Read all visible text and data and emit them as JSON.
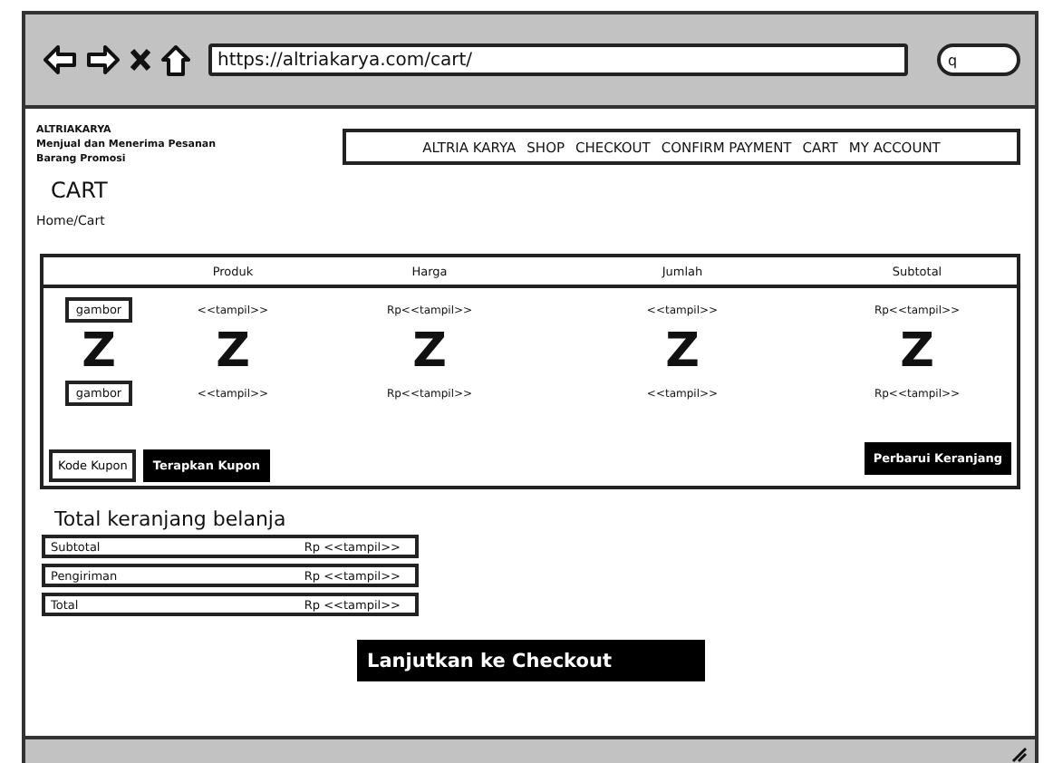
{
  "browser": {
    "url": "https://altriakarya.com/cart/",
    "search": {
      "placeholder": "q"
    }
  },
  "header": {
    "brand": "ALTRIAKARYA",
    "tagline": [
      "Menjual dan Menerima Pesanan",
      "Barang Promosi"
    ],
    "nav": [
      "ALTRIA KARYA",
      "SHOP",
      "CHECKOUT",
      "CONFIRM PAYMENT",
      "CART",
      "MY ACCOUNT"
    ]
  },
  "page_title": "CART",
  "breadcrumb": "Home/Cart",
  "cart_table": {
    "columns": [
      "",
      "Produk",
      "Harga",
      "Jumlah",
      "Subtotal"
    ],
    "rows": [
      [
        {
          "kind": "box",
          "text": "gambor"
        },
        {
          "kind": "text",
          "text": "<<tampil>>"
        },
        {
          "kind": "text",
          "text": "Rp<<tampil>>"
        },
        {
          "kind": "text",
          "text": "<<tampil>>"
        },
        {
          "kind": "text",
          "text": "Rp<<tampil>>"
        }
      ],
      [
        {
          "kind": "big",
          "text": "Z"
        },
        {
          "kind": "big",
          "text": "Z"
        },
        {
          "kind": "big",
          "text": "Z"
        },
        {
          "kind": "big",
          "text": "Z"
        },
        {
          "kind": "big",
          "text": "Z"
        }
      ],
      [
        {
          "kind": "box",
          "text": "gambor"
        },
        {
          "kind": "text",
          "text": "<<tampil>>"
        },
        {
          "kind": "text",
          "text": "Rp<<tampil>>"
        },
        {
          "kind": "text",
          "text": "<<tampil>>"
        },
        {
          "kind": "text",
          "text": "Rp<<tampil>>"
        }
      ]
    ],
    "coupon_button": "Kode Kupon",
    "apply_button": "Terapkan Kupon",
    "update_button": "Perbarui Keranjang"
  },
  "totals": {
    "title": "Total keranjang belanja",
    "rows": [
      {
        "label": "Subtotal",
        "value": "Rp <<tampil>>"
      },
      {
        "label": "Pengiriman",
        "value": "Rp <<tampil>>"
      },
      {
        "label": "Total",
        "value": "Rp <<tampil>>"
      }
    ]
  },
  "checkout_button": "Lanjutkan ke Checkout"
}
